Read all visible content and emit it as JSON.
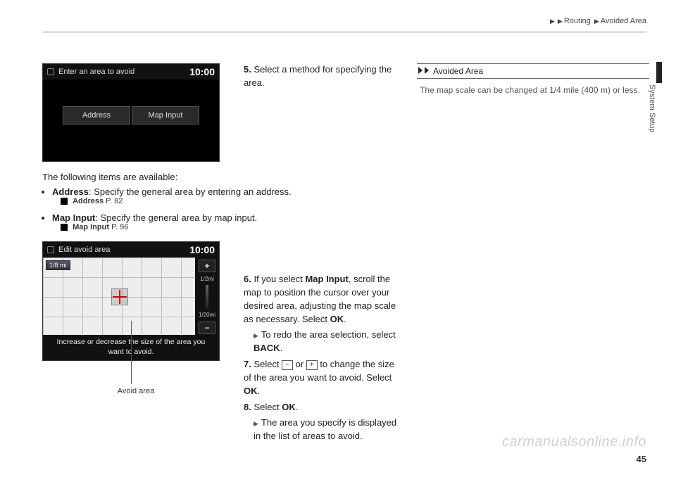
{
  "header": {
    "nav1": "Routing",
    "nav2": "Avoided Area"
  },
  "side_section": "System Setup",
  "screenshot1": {
    "title": "Enter an area to avoid",
    "time": "10:00",
    "btn_address": "Address",
    "btn_mapinput": "Map Input"
  },
  "step5": {
    "num": "5.",
    "text": "Select a method for specifying the area."
  },
  "items_intro": "The following items are available:",
  "bullet_address": {
    "label": "Address",
    "desc": ": Specify the general area by entering an address.",
    "ref_label": "Address",
    "ref_page": "P. 82"
  },
  "bullet_mapinput": {
    "label": "Map Input",
    "desc": ": Specify the general area by map input.",
    "ref_label": "Map Input",
    "ref_page": "P. 96"
  },
  "screenshot2": {
    "title": "Edit avoid area",
    "time": "10:00",
    "scale_badge": "1/8 mi",
    "zoom_plus": "+",
    "zoom_label1": "1/2mi",
    "zoom_label2": "1/20mi",
    "zoom_minus": "−",
    "msg": "Increase or decrease the size of the area you want to avoid."
  },
  "callout": "Avoid area",
  "step6": {
    "num": "6.",
    "line1": "If you select ",
    "bold1": "Map Input",
    "line2": ", scroll the map to position the cursor over your desired area, adjusting the map scale as necessary. Select ",
    "bold2": "OK",
    "line3": ".",
    "sub_line1": "To redo the area selection, select ",
    "sub_bold": "BACK",
    "sub_line2": "."
  },
  "step7": {
    "num": "7.",
    "line1": "Select ",
    "btn_minus": "−",
    "line2": " or ",
    "btn_plus": "+",
    "line3": " to change the size of the area you want to avoid. Select ",
    "bold1": "OK",
    "line4": "."
  },
  "step8": {
    "num": "8.",
    "line1": "Select ",
    "bold1": "OK",
    "line2": ".",
    "sub": "The area you specify is displayed in the list of areas to avoid."
  },
  "sidebar": {
    "head": "Avoided Area",
    "body": "The map scale can be changed at 1/4 mile (400 m) or less."
  },
  "page_number": "45",
  "watermark": "carmanualsonline.info"
}
